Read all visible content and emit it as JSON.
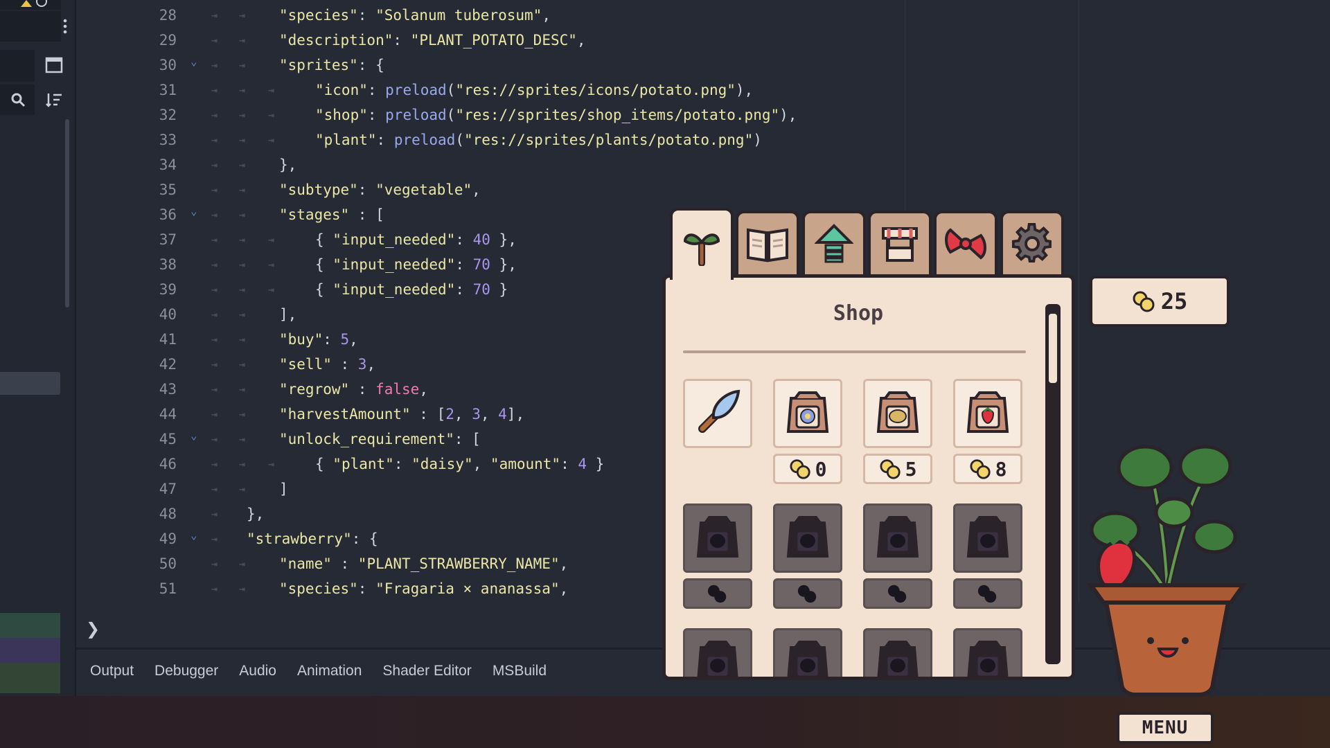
{
  "editor": {
    "lines": [
      {
        "num": "28",
        "tabs": 2,
        "fold": false,
        "tokens": [
          {
            "t": "\"species\"",
            "c": "s"
          },
          {
            "t": ": ",
            "c": "p"
          },
          {
            "t": "\"Solanum tuberosum\"",
            "c": "s"
          },
          {
            "t": ",",
            "c": "p"
          }
        ]
      },
      {
        "num": "29",
        "tabs": 2,
        "fold": false,
        "tokens": [
          {
            "t": "\"description\"",
            "c": "s"
          },
          {
            "t": ": ",
            "c": "p"
          },
          {
            "t": "\"PLANT_POTATO_DESC\"",
            "c": "s"
          },
          {
            "t": ",",
            "c": "p"
          }
        ]
      },
      {
        "num": "30",
        "tabs": 2,
        "fold": true,
        "tokens": [
          {
            "t": "\"sprites\"",
            "c": "s"
          },
          {
            "t": ": {",
            "c": "p"
          }
        ]
      },
      {
        "num": "31",
        "tabs": 3,
        "fold": false,
        "tokens": [
          {
            "t": "\"icon\"",
            "c": "s"
          },
          {
            "t": ": ",
            "c": "p"
          },
          {
            "t": "preload",
            "c": "f"
          },
          {
            "t": "(",
            "c": "p"
          },
          {
            "t": "\"res://sprites/icons/potato.png\"",
            "c": "s"
          },
          {
            "t": "),",
            "c": "p"
          }
        ]
      },
      {
        "num": "32",
        "tabs": 3,
        "fold": false,
        "tokens": [
          {
            "t": "\"shop\"",
            "c": "s"
          },
          {
            "t": ": ",
            "c": "p"
          },
          {
            "t": "preload",
            "c": "f"
          },
          {
            "t": "(",
            "c": "p"
          },
          {
            "t": "\"res://sprites/shop_items/potato.png\"",
            "c": "s"
          },
          {
            "t": "),",
            "c": "p"
          }
        ]
      },
      {
        "num": "33",
        "tabs": 3,
        "fold": false,
        "tokens": [
          {
            "t": "\"plant\"",
            "c": "s"
          },
          {
            "t": ": ",
            "c": "p"
          },
          {
            "t": "preload",
            "c": "f"
          },
          {
            "t": "(",
            "c": "p"
          },
          {
            "t": "\"res://sprites/plants/potato.png\"",
            "c": "s"
          },
          {
            "t": ")",
            "c": "p"
          }
        ]
      },
      {
        "num": "34",
        "tabs": 2,
        "fold": false,
        "tokens": [
          {
            "t": "},",
            "c": "p"
          }
        ]
      },
      {
        "num": "35",
        "tabs": 2,
        "fold": false,
        "tokens": [
          {
            "t": "\"subtype\"",
            "c": "s"
          },
          {
            "t": ": ",
            "c": "p"
          },
          {
            "t": "\"vegetable\"",
            "c": "s"
          },
          {
            "t": ",",
            "c": "p"
          }
        ]
      },
      {
        "num": "36",
        "tabs": 2,
        "fold": true,
        "tokens": [
          {
            "t": "\"stages\"",
            "c": "s"
          },
          {
            "t": " : [",
            "c": "p"
          }
        ]
      },
      {
        "num": "37",
        "tabs": 3,
        "fold": false,
        "tokens": [
          {
            "t": "{ ",
            "c": "p"
          },
          {
            "t": "\"input_needed\"",
            "c": "s"
          },
          {
            "t": ": ",
            "c": "p"
          },
          {
            "t": "40",
            "c": "n"
          },
          {
            "t": " },",
            "c": "p"
          }
        ]
      },
      {
        "num": "38",
        "tabs": 3,
        "fold": false,
        "tokens": [
          {
            "t": "{ ",
            "c": "p"
          },
          {
            "t": "\"input_needed\"",
            "c": "s"
          },
          {
            "t": ": ",
            "c": "p"
          },
          {
            "t": "70",
            "c": "n"
          },
          {
            "t": " },",
            "c": "p"
          }
        ]
      },
      {
        "num": "39",
        "tabs": 3,
        "fold": false,
        "tokens": [
          {
            "t": "{ ",
            "c": "p"
          },
          {
            "t": "\"input_needed\"",
            "c": "s"
          },
          {
            "t": ": ",
            "c": "p"
          },
          {
            "t": "70",
            "c": "n"
          },
          {
            "t": " }",
            "c": "p"
          }
        ]
      },
      {
        "num": "40",
        "tabs": 2,
        "fold": false,
        "tokens": [
          {
            "t": "],",
            "c": "p"
          }
        ]
      },
      {
        "num": "41",
        "tabs": 2,
        "fold": false,
        "tokens": [
          {
            "t": "\"buy\"",
            "c": "s"
          },
          {
            "t": ": ",
            "c": "p"
          },
          {
            "t": "5",
            "c": "n"
          },
          {
            "t": ",",
            "c": "p"
          }
        ]
      },
      {
        "num": "42",
        "tabs": 2,
        "fold": false,
        "tokens": [
          {
            "t": "\"sell\"",
            "c": "s"
          },
          {
            "t": " : ",
            "c": "p"
          },
          {
            "t": "3",
            "c": "n"
          },
          {
            "t": ",",
            "c": "p"
          }
        ]
      },
      {
        "num": "43",
        "tabs": 2,
        "fold": false,
        "tokens": [
          {
            "t": "\"regrow\"",
            "c": "s"
          },
          {
            "t": " : ",
            "c": "p"
          },
          {
            "t": "false",
            "c": "k"
          },
          {
            "t": ",",
            "c": "p"
          }
        ]
      },
      {
        "num": "44",
        "tabs": 2,
        "fold": false,
        "tokens": [
          {
            "t": "\"harvestAmount\"",
            "c": "s"
          },
          {
            "t": " : [",
            "c": "p"
          },
          {
            "t": "2",
            "c": "n"
          },
          {
            "t": ", ",
            "c": "p"
          },
          {
            "t": "3",
            "c": "n"
          },
          {
            "t": ", ",
            "c": "p"
          },
          {
            "t": "4",
            "c": "n"
          },
          {
            "t": "],",
            "c": "p"
          }
        ]
      },
      {
        "num": "45",
        "tabs": 2,
        "fold": true,
        "tokens": [
          {
            "t": "\"unlock_requirement\"",
            "c": "s"
          },
          {
            "t": ": [",
            "c": "p"
          }
        ]
      },
      {
        "num": "46",
        "tabs": 3,
        "fold": false,
        "tokens": [
          {
            "t": "{ ",
            "c": "p"
          },
          {
            "t": "\"plant\"",
            "c": "s"
          },
          {
            "t": ": ",
            "c": "p"
          },
          {
            "t": "\"daisy\"",
            "c": "s"
          },
          {
            "t": ", ",
            "c": "p"
          },
          {
            "t": "\"amount\"",
            "c": "s"
          },
          {
            "t": ": ",
            "c": "p"
          },
          {
            "t": "4",
            "c": "n"
          },
          {
            "t": " }",
            "c": "p"
          }
        ]
      },
      {
        "num": "47",
        "tabs": 2,
        "fold": false,
        "tokens": [
          {
            "t": "]",
            "c": "p"
          }
        ]
      },
      {
        "num": "48",
        "tabs": 1,
        "fold": false,
        "tokens": [
          {
            "t": "},",
            "c": "p"
          }
        ]
      },
      {
        "num": "49",
        "tabs": 1,
        "fold": true,
        "tokens": [
          {
            "t": "\"strawberry\"",
            "c": "s"
          },
          {
            "t": ": {",
            "c": "p"
          }
        ]
      },
      {
        "num": "50",
        "tabs": 2,
        "fold": false,
        "tokens": [
          {
            "t": "\"name\"",
            "c": "s"
          },
          {
            "t": " : ",
            "c": "p"
          },
          {
            "t": "\"PLANT_STRAWBERRY_NAME\"",
            "c": "s"
          },
          {
            "t": ",",
            "c": "p"
          }
        ]
      },
      {
        "num": "51",
        "tabs": 2,
        "fold": false,
        "tokens": [
          {
            "t": "\"species\"",
            "c": "s"
          },
          {
            "t": ": ",
            "c": "p"
          },
          {
            "t": "\"Fragaria × ananassa\"",
            "c": "s"
          },
          {
            "t": ",",
            "c": "p"
          }
        ]
      }
    ],
    "syntax_colors": {
      "string": "#ece7a6",
      "punct": "#d4d7de",
      "number": "#a996ec",
      "function": "#9aa8ee",
      "keyword": "#f07ab0"
    }
  },
  "console": {
    "prompt": "❯"
  },
  "bottom_panel": {
    "tabs": [
      "Output",
      "Debugger",
      "Audio",
      "Animation",
      "Shader Editor",
      "MSBuild"
    ]
  },
  "sidebar": {
    "icons": [
      "more-vertical-icon",
      "window-icon",
      "search-icon",
      "sort-icon"
    ]
  },
  "game": {
    "tabs": [
      {
        "name": "sprout-icon",
        "active": true
      },
      {
        "name": "book-icon",
        "active": false
      },
      {
        "name": "upgrade-arrow-icon",
        "active": false
      },
      {
        "name": "market-stall-icon",
        "active": false
      },
      {
        "name": "bow-icon",
        "active": false
      },
      {
        "name": "gear-icon",
        "active": false
      }
    ],
    "shop": {
      "title": "Shop",
      "items": [
        {
          "icon": "trowel-icon",
          "locked": false,
          "price": null
        },
        {
          "icon": "daisy-seed-packet-icon",
          "locked": false,
          "price": "0"
        },
        {
          "icon": "potato-seed-packet-icon",
          "locked": false,
          "price": "5"
        },
        {
          "icon": "strawberry-seed-packet-icon",
          "locked": false,
          "price": "8"
        },
        {
          "icon": "locked-seed-packet-icon",
          "locked": true,
          "price": null
        },
        {
          "icon": "locked-seed-packet-icon",
          "locked": true,
          "price": null
        },
        {
          "icon": "locked-seed-packet-icon",
          "locked": true,
          "price": null
        },
        {
          "icon": "locked-seed-packet-icon",
          "locked": true,
          "price": null
        },
        {
          "icon": "locked-seed-packet-icon",
          "locked": true,
          "price": null
        },
        {
          "icon": "locked-seed-packet-icon",
          "locked": true,
          "price": null
        },
        {
          "icon": "locked-seed-packet-icon",
          "locked": true,
          "price": null
        },
        {
          "icon": "locked-seed-packet-icon",
          "locked": true,
          "price": null
        }
      ]
    },
    "coins": "25",
    "menu_label": "MENU",
    "colors": {
      "cream": "#f3e2d1",
      "outline": "#2a2329",
      "tab_brown": "#c8a48b",
      "locked": "#6e6466"
    }
  }
}
